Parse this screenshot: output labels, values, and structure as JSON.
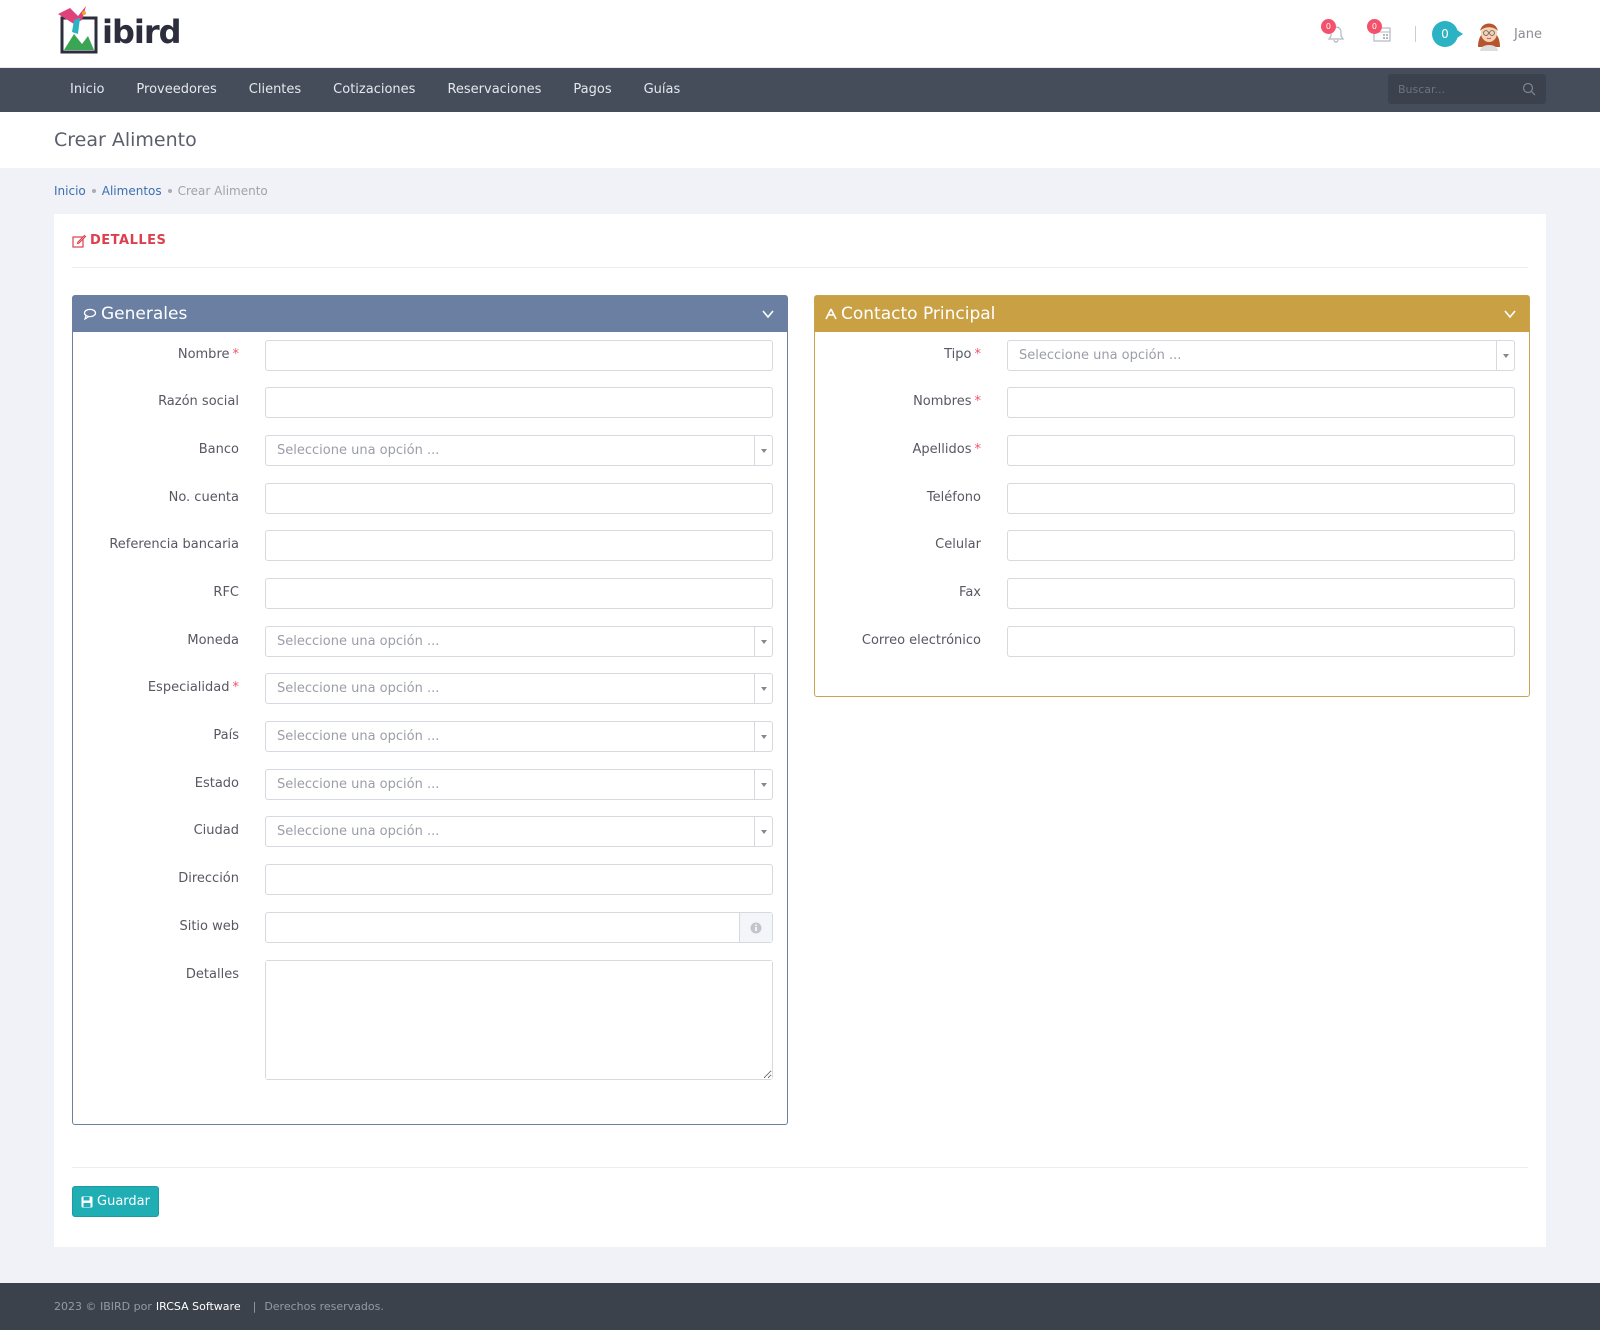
{
  "app": {
    "logo_text": "ibird",
    "user_name": "Jane",
    "notifications_count": "0",
    "calendar_count": "0",
    "chat_count": "0"
  },
  "nav": {
    "items": [
      "Inicio",
      "Proveedores",
      "Clientes",
      "Cotizaciones",
      "Reservaciones",
      "Pagos",
      "Guías"
    ],
    "search_placeholder": "Buscar..."
  },
  "page": {
    "title": "Crear Alimento",
    "breadcrumb": [
      "Inicio",
      "Alimentos",
      "Crear Alimento"
    ]
  },
  "portlet": {
    "title": "DETALLES"
  },
  "generales": {
    "title": "Generales",
    "select_placeholder": "Seleccione una opción ...",
    "fields": [
      {
        "label": "Nombre",
        "required": true,
        "type": "text",
        "value": ""
      },
      {
        "label": "Razón social",
        "required": false,
        "type": "text",
        "value": ""
      },
      {
        "label": "Banco",
        "required": false,
        "type": "select",
        "value": "Seleccione una opción ..."
      },
      {
        "label": "No. cuenta",
        "required": false,
        "type": "text",
        "value": ""
      },
      {
        "label": "Referencia bancaria",
        "required": false,
        "type": "text",
        "value": ""
      },
      {
        "label": "RFC",
        "required": false,
        "type": "text",
        "value": ""
      },
      {
        "label": "Moneda",
        "required": false,
        "type": "select",
        "value": "Seleccione una opción ..."
      },
      {
        "label": "Especialidad",
        "required": true,
        "type": "select",
        "value": "Seleccione una opción ..."
      },
      {
        "label": "País",
        "required": false,
        "type": "select",
        "value": "Seleccione una opción ..."
      },
      {
        "label": "Estado",
        "required": false,
        "type": "select",
        "value": "Seleccione una opción ..."
      },
      {
        "label": "Ciudad",
        "required": false,
        "type": "select",
        "value": "Seleccione una opción ..."
      },
      {
        "label": "Dirección",
        "required": false,
        "type": "text",
        "value": ""
      },
      {
        "label": "Sitio web",
        "required": false,
        "type": "addon",
        "value": ""
      },
      {
        "label": "Detalles",
        "required": false,
        "type": "textarea",
        "value": ""
      }
    ]
  },
  "contacto": {
    "title": "Contacto Principal",
    "fields": [
      {
        "label": "Tipo",
        "required": true,
        "type": "select",
        "value": "Seleccione una opción ..."
      },
      {
        "label": "Nombres",
        "required": true,
        "type": "text",
        "value": ""
      },
      {
        "label": "Apellidos",
        "required": true,
        "type": "text",
        "value": ""
      },
      {
        "label": "Teléfono",
        "required": false,
        "type": "text",
        "value": ""
      },
      {
        "label": "Celular",
        "required": false,
        "type": "text",
        "value": ""
      },
      {
        "label": "Fax",
        "required": false,
        "type": "text",
        "value": ""
      },
      {
        "label": "Correo electrónico",
        "required": false,
        "type": "text",
        "value": ""
      }
    ]
  },
  "actions": {
    "save_label": "Guardar"
  },
  "footer": {
    "prefix": "2023 © IBIRD por",
    "brand": "IRCSA Software",
    "separator": "|",
    "suffix": "Derechos reservados."
  },
  "colors": {
    "generales_header": "#6a7fa2",
    "contacto_header": "#c9a144",
    "accent_red": "#dc3f4d",
    "save_button": "#20aeb5",
    "navbar": "#454d5a",
    "footer": "#3c424c"
  }
}
